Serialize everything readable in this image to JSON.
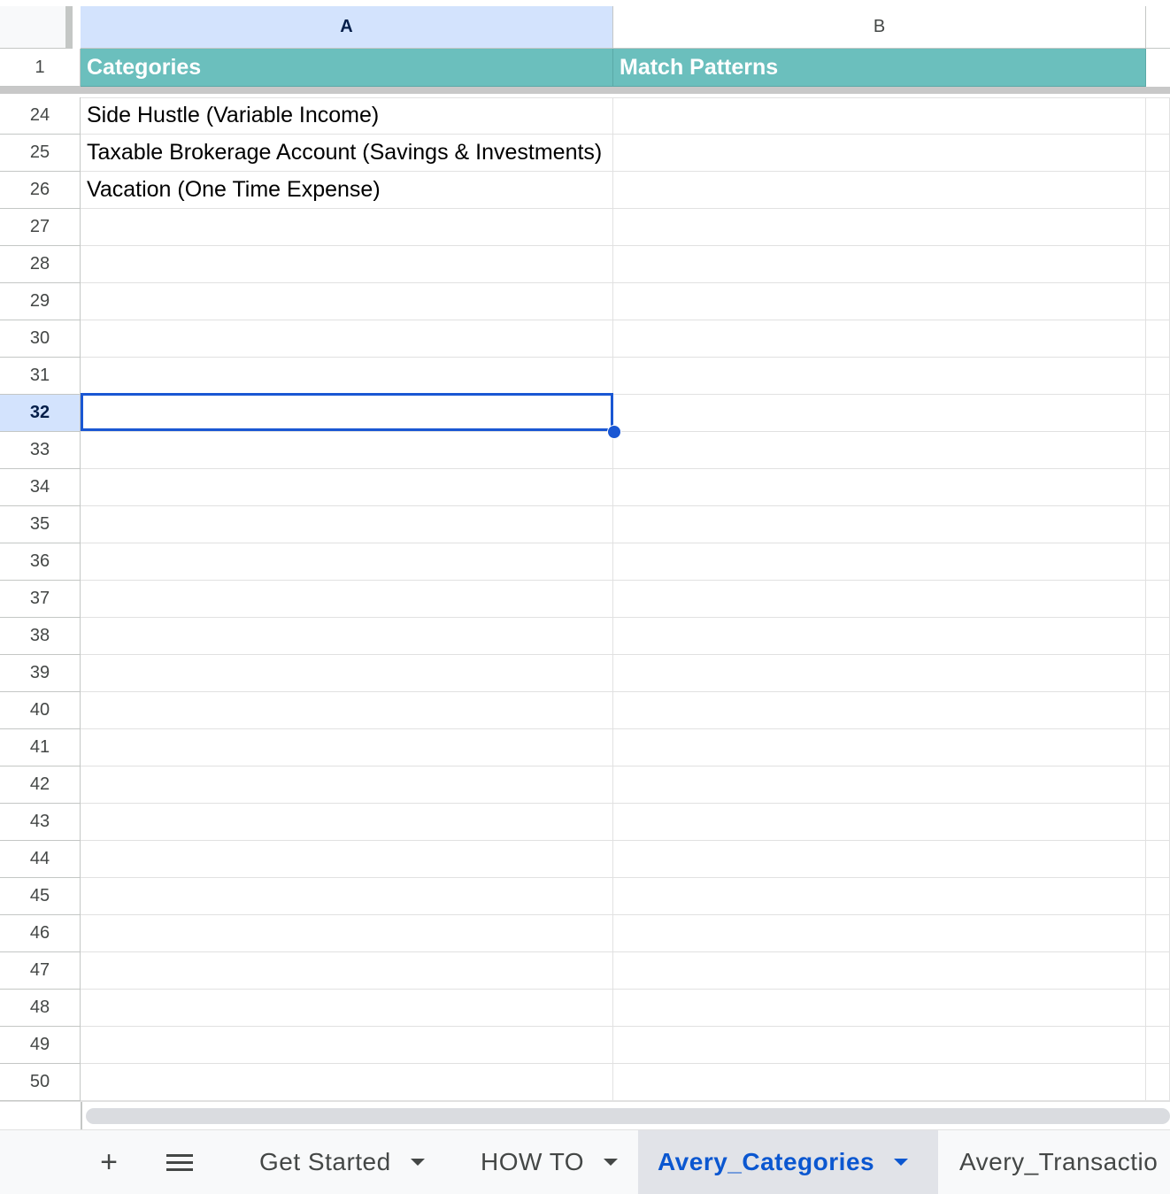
{
  "columns": [
    {
      "letter": "A"
    },
    {
      "letter": "B"
    }
  ],
  "header_row": {
    "number": "1",
    "cells": [
      "Categories",
      "Match Patterns"
    ]
  },
  "rows": [
    {
      "number": "24",
      "a": "Side Hustle (Variable Income)"
    },
    {
      "number": "25",
      "a": "Taxable Brokerage Account (Savings & Investments)"
    },
    {
      "number": "26",
      "a": "Vacation (One Time Expense)"
    },
    {
      "number": "27",
      "a": ""
    },
    {
      "number": "28",
      "a": ""
    },
    {
      "number": "29",
      "a": ""
    },
    {
      "number": "30",
      "a": ""
    },
    {
      "number": "31",
      "a": ""
    },
    {
      "number": "32",
      "a": ""
    },
    {
      "number": "33",
      "a": ""
    },
    {
      "number": "34",
      "a": ""
    },
    {
      "number": "35",
      "a": ""
    },
    {
      "number": "36",
      "a": ""
    },
    {
      "number": "37",
      "a": ""
    },
    {
      "number": "38",
      "a": ""
    },
    {
      "number": "39",
      "a": ""
    },
    {
      "number": "40",
      "a": ""
    },
    {
      "number": "41",
      "a": ""
    },
    {
      "number": "42",
      "a": ""
    },
    {
      "number": "43",
      "a": ""
    },
    {
      "number": "44",
      "a": ""
    },
    {
      "number": "45",
      "a": ""
    },
    {
      "number": "46",
      "a": ""
    },
    {
      "number": "47",
      "a": ""
    },
    {
      "number": "48",
      "a": ""
    },
    {
      "number": "49",
      "a": ""
    },
    {
      "number": "50",
      "a": ""
    }
  ],
  "selected_cell": {
    "column": "A",
    "row": "32"
  },
  "tabs": [
    {
      "label": "Get Started",
      "active": false
    },
    {
      "label": "HOW TO",
      "active": false
    },
    {
      "label": "Avery_Categories",
      "active": true
    },
    {
      "label": "Avery_Transactio",
      "active": false
    }
  ],
  "icons": {
    "add_sheet": "plus-icon",
    "all_sheets": "menu-icon"
  },
  "colors": {
    "header_fill": "#6bbfbd",
    "selection": "#1a57d3",
    "active_tab_text": "#0b57d0"
  }
}
